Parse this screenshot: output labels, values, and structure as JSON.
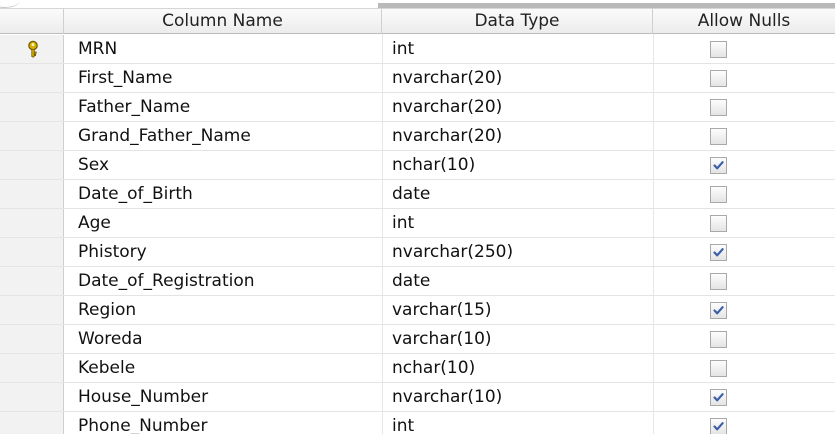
{
  "header": {
    "column_name": "Column Name",
    "data_type": "Data Type",
    "allow_nulls": "Allow Nulls"
  },
  "rows": [
    {
      "name": "MRN",
      "type": "int",
      "allow_nulls": false,
      "primary_key": true
    },
    {
      "name": "First_Name",
      "type": "nvarchar(20)",
      "allow_nulls": false
    },
    {
      "name": "Father_Name",
      "type": "nvarchar(20)",
      "allow_nulls": false
    },
    {
      "name": "Grand_Father_Name",
      "type": "nvarchar(20)",
      "allow_nulls": false
    },
    {
      "name": "Sex",
      "type": "nchar(10)",
      "allow_nulls": true
    },
    {
      "name": "Date_of_Birth",
      "type": "date",
      "allow_nulls": false
    },
    {
      "name": "Age",
      "type": "int",
      "allow_nulls": false
    },
    {
      "name": "Phistory",
      "type": "nvarchar(250)",
      "allow_nulls": true
    },
    {
      "name": "Date_of_Registration",
      "type": "date",
      "allow_nulls": false
    },
    {
      "name": "Region",
      "type": "varchar(15)",
      "allow_nulls": true
    },
    {
      "name": "Woreda",
      "type": "varchar(10)",
      "allow_nulls": false
    },
    {
      "name": "Kebele",
      "type": "nchar(10)",
      "allow_nulls": false
    },
    {
      "name": "House_Number",
      "type": "nvarchar(10)",
      "allow_nulls": true
    },
    {
      "name": "Phone_Number",
      "type": "int",
      "allow_nulls": true
    }
  ],
  "icons": {
    "primary_key": "key-icon",
    "checkbox_checked": "checkmark-icon"
  },
  "colors": {
    "key": "#d9b000",
    "check": "#3d5fa8",
    "header_bg": "#f1f1f1"
  }
}
